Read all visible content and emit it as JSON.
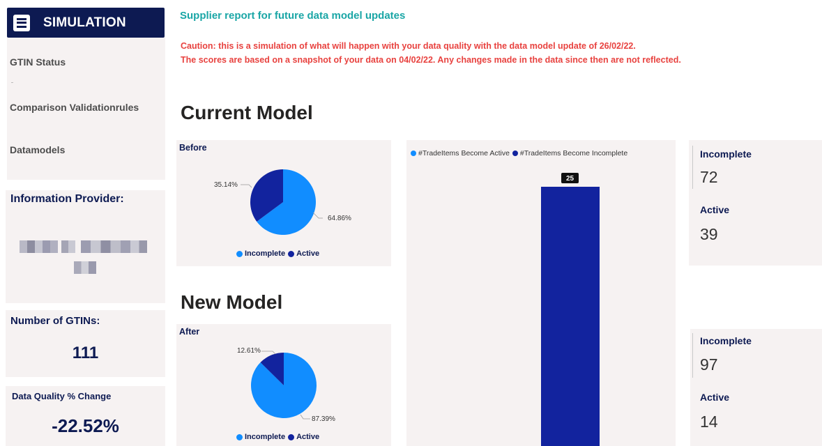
{
  "nav": {
    "title": "SIMULATION",
    "items": [
      {
        "label": "GTIN Status"
      },
      {
        "label": "Comparison Validationrules"
      },
      {
        "label": "Datamodels"
      }
    ]
  },
  "side": {
    "provider_title": "Information Provider:",
    "gtins_title": "Number of GTINs:",
    "gtins_value": "111",
    "dq_title": "Data Quality % Change",
    "dq_value": "-22.52%"
  },
  "header": {
    "title": "Supplier report for future data model updates",
    "caution_1": "Caution: this is a simulation of what will happen with your data quality with the data model update of 26/02/22.",
    "caution_2": "The scores are based on a snapshot of your data on 04/02/22. Any changes made in the data since then are not reflected."
  },
  "current_model": {
    "title": "Current Model",
    "chart_title": "Before",
    "labels": {
      "active": "35.14%",
      "incomplete": "64.86%"
    },
    "kpis": {
      "incomplete_label": "Incomplete",
      "incomplete_value": "72",
      "active_label": "Active",
      "active_value": "39"
    }
  },
  "new_model": {
    "title": "New Model",
    "chart_title": "After",
    "labels": {
      "active": "12.61%",
      "incomplete": "87.39%"
    },
    "kpis": {
      "incomplete_label": "Incomplete",
      "incomplete_value": "97",
      "active_label": "Active",
      "active_value": "14"
    }
  },
  "legend": {
    "incomplete": "Incomplete",
    "active": "Active"
  },
  "bar_legend": {
    "become_active": "#TradeItems Become Active",
    "become_incomplete": "#TradeItems Become Incomplete"
  },
  "colors": {
    "incomplete": "#118dff",
    "active": "#12239e",
    "nav": "#0d1a52",
    "caution": "#e8423f",
    "title": "#1aa6a6"
  },
  "chart_data": [
    {
      "type": "pie",
      "title": "Before",
      "categories": [
        "Incomplete",
        "Active"
      ],
      "values": [
        64.86,
        35.14
      ],
      "legend": "bottom"
    },
    {
      "type": "pie",
      "title": "After",
      "categories": [
        "Incomplete",
        "Active"
      ],
      "values": [
        87.39,
        12.61
      ],
      "legend": "bottom"
    },
    {
      "type": "bar",
      "series": [
        {
          "name": "#TradeItems Become Active",
          "values": [
            0
          ]
        },
        {
          "name": "#TradeItems Become Incomplete",
          "values": [
            25
          ]
        }
      ],
      "data_labels": [
        "25"
      ],
      "legend": "top-left"
    }
  ]
}
